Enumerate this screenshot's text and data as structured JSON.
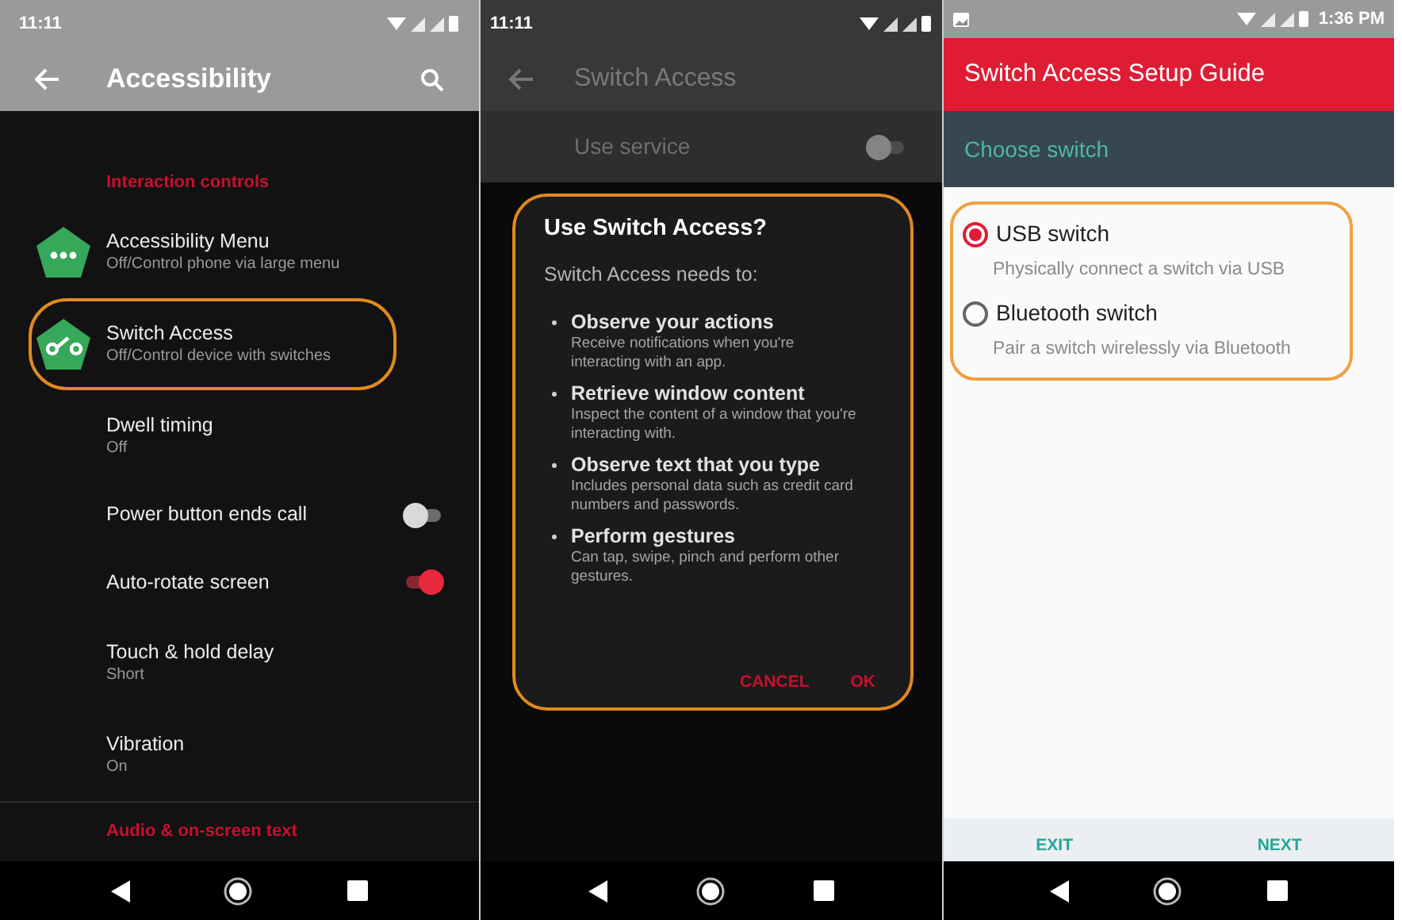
{
  "settings_screen": {
    "status_bar": {
      "time": "11:11"
    },
    "toolbar": {
      "title": "Accessibility"
    },
    "items": [
      {
        "kind": "header",
        "title": "Interaction controls"
      },
      {
        "kind": "app",
        "title": "Accessibility Menu",
        "summary": "Off/Control phone via large menu",
        "highlighted": false
      },
      {
        "kind": "app",
        "title": "Switch Access",
        "summary": "Off/Control device with switches",
        "highlighted": true
      },
      {
        "kind": "text",
        "title": "Dwell timing",
        "summary": "Off"
      },
      {
        "kind": "toggle",
        "title": "Power button ends call",
        "on": false
      },
      {
        "kind": "toggle",
        "title": "Auto-rotate screen",
        "on": true
      },
      {
        "kind": "text",
        "title": "Touch & hold delay",
        "summary": "Short"
      },
      {
        "kind": "text",
        "title": "Vibration",
        "summary": "On"
      },
      {
        "kind": "header",
        "title": "Audio & on-screen text"
      }
    ]
  },
  "permission_screen": {
    "status_bar": {
      "time": "11:11"
    },
    "toolbar": {
      "title": "Switch Access"
    },
    "service": {
      "label": "Use service",
      "on": false
    },
    "dialog": {
      "title": "Use Switch Access?",
      "intro": "Switch Access needs to:",
      "highlighted": true,
      "permissions": [
        {
          "title": "Observe your actions",
          "description": "Receive notifications when you're interacting with an app."
        },
        {
          "title": "Retrieve window content",
          "description": "Inspect the content of a window that you're interacting with."
        },
        {
          "title": "Observe text that you type",
          "description": "Includes personal data such as credit card numbers and passwords."
        },
        {
          "title": "Perform gestures",
          "description": "Can tap, swipe, pinch and perform other gestures."
        }
      ],
      "buttons": [
        "CANCEL",
        "OK"
      ]
    }
  },
  "setup_screen": {
    "status_bar": {
      "time": "1:36 PM"
    },
    "header": "Switch Access Setup Guide",
    "subheader": "Choose switch",
    "options_highlighted": true,
    "options": [
      {
        "title": "USB switch",
        "description": "Physically connect a switch via USB",
        "selected": true
      },
      {
        "title": "Bluetooth switch",
        "description": "Pair a switch wirelessly via Bluetooth",
        "selected": false
      }
    ],
    "footer_buttons": [
      "EXIT",
      "NEXT"
    ]
  }
}
